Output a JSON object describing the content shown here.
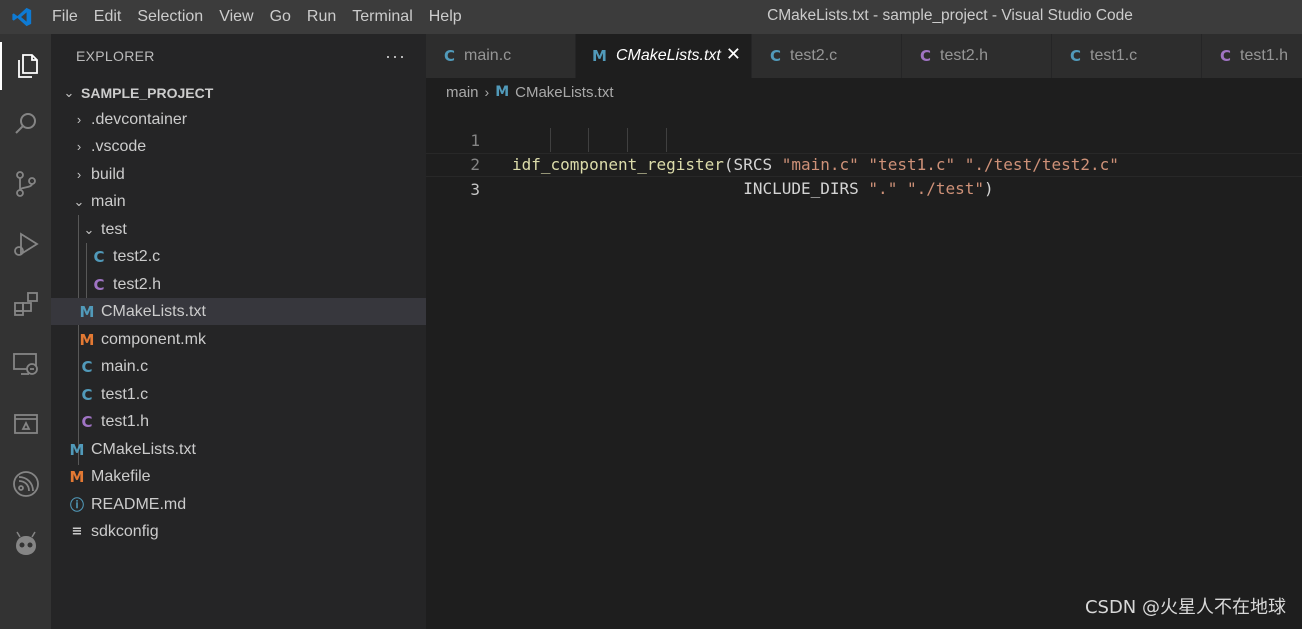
{
  "titlebar": {
    "menu": [
      "File",
      "Edit",
      "Selection",
      "View",
      "Go",
      "Run",
      "Terminal",
      "Help"
    ],
    "window_title": "CMakeLists.txt - sample_project - Visual Studio Code"
  },
  "activity_bar": {
    "icons": [
      "explorer-icon",
      "search-icon",
      "source-control-icon",
      "run-debug-icon",
      "extensions-icon",
      "remote-explorer-icon",
      "terminal-panel-icon",
      "espressif-icon",
      "platformio-icon"
    ]
  },
  "sidebar": {
    "title": "EXPLORER",
    "more": "···",
    "root": "SAMPLE_PROJECT",
    "items": [
      {
        "label": ".devcontainer",
        "type": "folder",
        "open": false,
        "icon": ""
      },
      {
        "label": ".vscode",
        "type": "folder",
        "open": false,
        "icon": ""
      },
      {
        "label": "build",
        "type": "folder",
        "open": false,
        "icon": ""
      },
      {
        "label": "main",
        "type": "folder",
        "open": true,
        "icon": ""
      },
      {
        "label": "test",
        "type": "folder",
        "open": true,
        "icon": ""
      },
      {
        "label": "test2.c",
        "type": "file",
        "icon": "C"
      },
      {
        "label": "test2.h",
        "type": "file",
        "icon": "C"
      },
      {
        "label": "CMakeLists.txt",
        "type": "file",
        "icon": "M"
      },
      {
        "label": "component.mk",
        "type": "file",
        "icon": "M"
      },
      {
        "label": "main.c",
        "type": "file",
        "icon": "C"
      },
      {
        "label": "test1.c",
        "type": "file",
        "icon": "C"
      },
      {
        "label": "test1.h",
        "type": "file",
        "icon": "C"
      },
      {
        "label": "CMakeLists.txt",
        "type": "file",
        "icon": "M"
      },
      {
        "label": "Makefile",
        "type": "file",
        "icon": "M"
      },
      {
        "label": "README.md",
        "type": "file",
        "icon": "ⓘ"
      },
      {
        "label": "sdkconfig",
        "type": "file",
        "icon": "≡"
      }
    ]
  },
  "tabs": [
    {
      "label": "main.c",
      "icon": "C"
    },
    {
      "label": "CMakeLists.txt",
      "icon": "M",
      "close": "✕"
    },
    {
      "label": "test2.c",
      "icon": "C"
    },
    {
      "label": "test2.h",
      "icon": "C"
    },
    {
      "label": "test1.c",
      "icon": "C"
    },
    {
      "label": "test1.h",
      "icon": "C"
    }
  ],
  "breadcrumb": {
    "folder": "main",
    "sep": "›",
    "icon": "M",
    "file": "CMakeLists.txt"
  },
  "editor": {
    "line_numbers": [
      "1",
      "2",
      "3"
    ],
    "line1": {
      "fn": "idf_component_register",
      "p1": "(SRCS ",
      "s1": "\"main.c\"",
      "sp1": " ",
      "s2": "\"test1.c\"",
      "sp2": " ",
      "s3": "\"./test/test2.c\""
    },
    "line2": {
      "indent": "                        ",
      "kw": "INCLUDE_DIRS ",
      "s1": "\".\"",
      "sp1": " ",
      "s2": "\"./test\"",
      "p2": ")"
    }
  },
  "watermark": "CSDN @火星人不在地球"
}
